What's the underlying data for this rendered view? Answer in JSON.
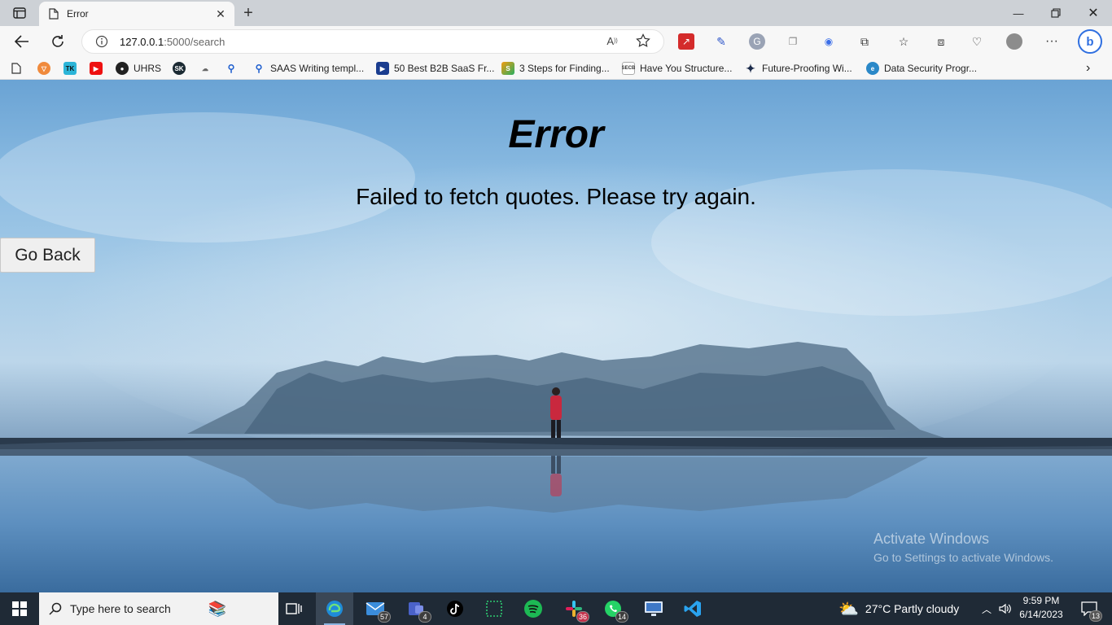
{
  "browser": {
    "tab_title": "Error",
    "url_host": "127.0.0.1",
    "url_path": ":5000/search",
    "favorites": [
      {
        "label": "",
        "icon": "brave-icon"
      },
      {
        "label": "",
        "icon": "tk-icon"
      },
      {
        "label": "",
        "icon": "youtube-icon"
      },
      {
        "label": "UHRS",
        "icon": "uhrs-icon"
      },
      {
        "label": "",
        "icon": "sk-icon"
      },
      {
        "label": "",
        "icon": "cloud-icon"
      },
      {
        "label": "",
        "icon": "search-icon"
      },
      {
        "label": "SAAS Writing templ...",
        "icon": "search-icon"
      },
      {
        "label": "50 Best B2B SaaS Fr...",
        "icon": "flag-icon"
      },
      {
        "label": "3 Steps for Finding...",
        "icon": "leaf-icon"
      },
      {
        "label": "Have You Structure...",
        "icon": "secb-icon"
      },
      {
        "label": "Future-Proofing Wi...",
        "icon": "star-icon"
      },
      {
        "label": "Data Security Progr...",
        "icon": "edge-icon"
      }
    ]
  },
  "page": {
    "title": "Error",
    "message": "Failed to fetch quotes. Please try again.",
    "back_button": "Go Back",
    "watermark_line1": "Activate Windows",
    "watermark_line2": "Go to Settings to activate Windows."
  },
  "taskbar": {
    "search_placeholder": "Type here to search",
    "badges": {
      "mail": "57",
      "teams": "4",
      "slack": "36",
      "whatsapp": "14"
    },
    "weather": "27°C  Partly cloudy",
    "time": "9:59 PM",
    "date": "6/14/2023",
    "notifications": "13"
  }
}
